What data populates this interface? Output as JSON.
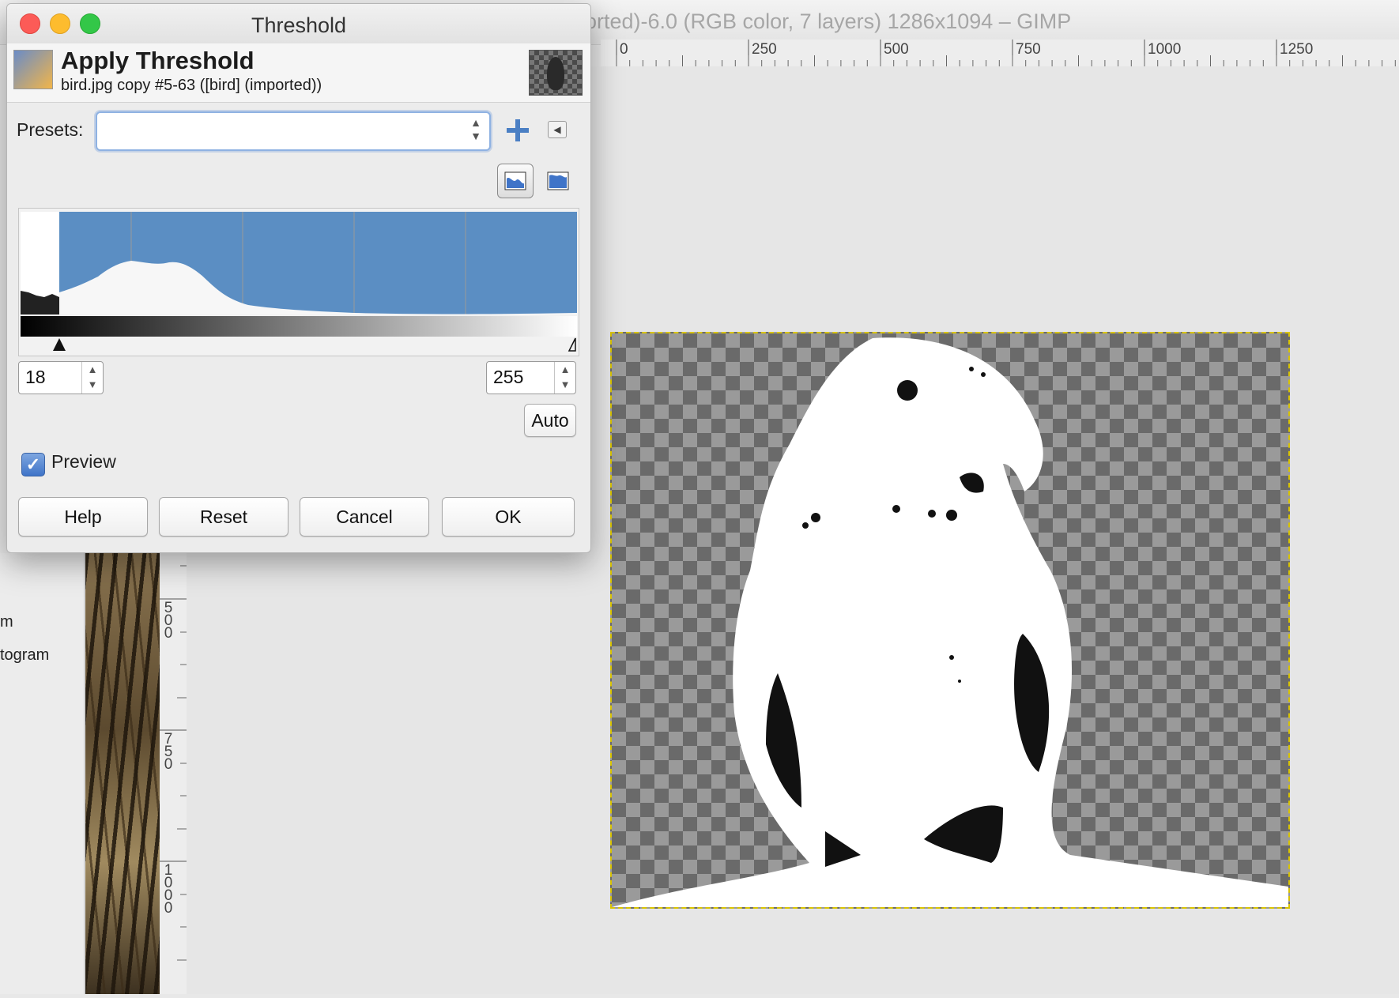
{
  "background_window": {
    "title": "orted)-6.0 (RGB color, 7 layers) 1286x1094 – GIMP",
    "ruler_h_labels": [
      "0",
      "250",
      "500",
      "750",
      "1000",
      "1250"
    ],
    "ruler_v_labels": [
      "500",
      "750",
      "1000"
    ],
    "left_panel_items": [
      "m",
      "togram"
    ]
  },
  "dialog": {
    "title": "Threshold",
    "header_title": "Apply Threshold",
    "header_subtitle": "bird.jpg copy #5-63 ([bird] (imported))",
    "presets_label": "Presets:",
    "presets_value": "",
    "low_value": "18",
    "high_value": "255",
    "auto_label": "Auto",
    "preview_label": "Preview",
    "preview_checked": true,
    "buttons": {
      "help": "Help",
      "reset": "Reset",
      "cancel": "Cancel",
      "ok": "OK"
    }
  },
  "colors": {
    "histogram_fill": "#5b8ec3",
    "accent": "#3f74c8"
  },
  "icons": [
    "add-preset-icon",
    "preset-menu-icon",
    "linear-histogram-icon",
    "log-histogram-icon",
    "apply-threshold-icon"
  ]
}
